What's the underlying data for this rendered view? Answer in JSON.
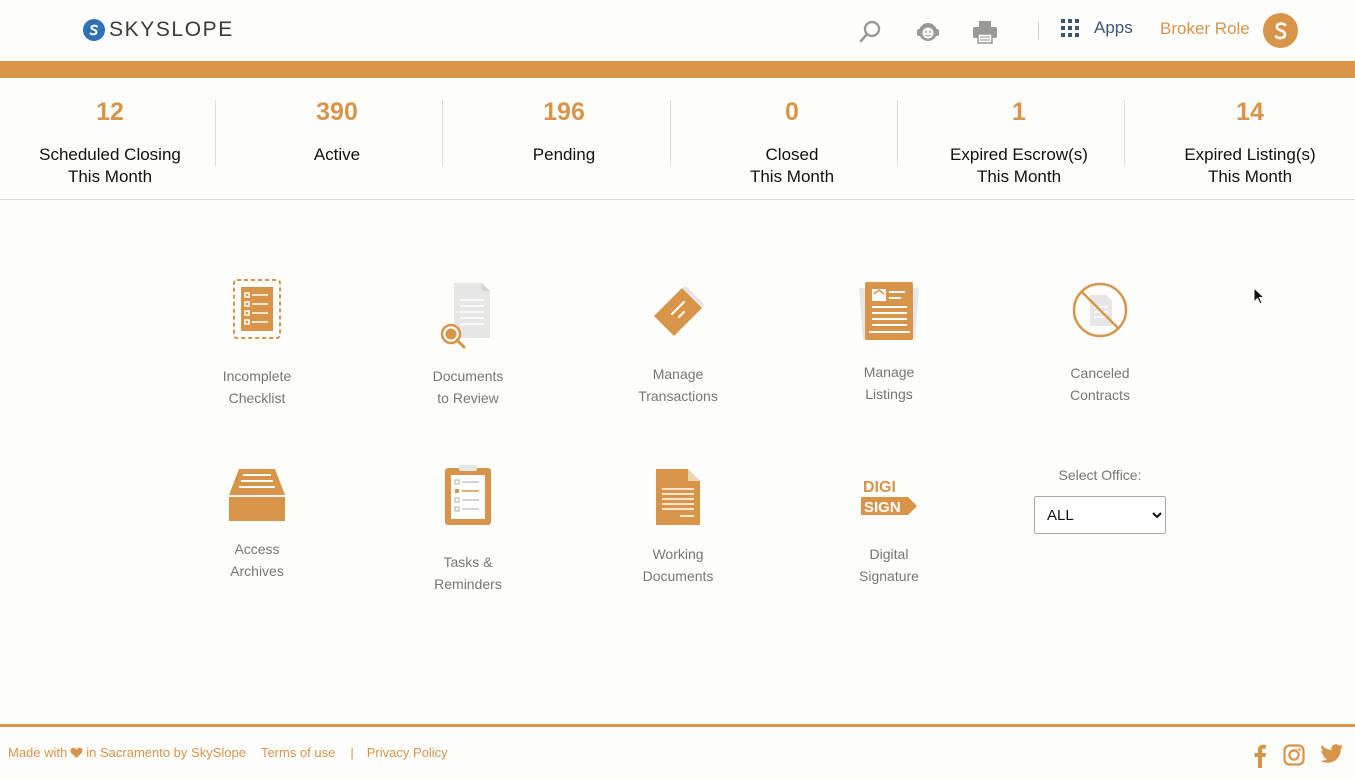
{
  "header": {
    "brand": "SKYSLOPE",
    "apps_label": "Apps",
    "role_label": "Broker Role",
    "icons": [
      "search-icon",
      "support-agent-icon",
      "printer-icon",
      "grid-apps-icon"
    ]
  },
  "colors": {
    "accent": "#d8954a",
    "brand_blue": "#2f6fb4",
    "apps_text": "#3b5574"
  },
  "stats": [
    {
      "value": "12",
      "label_line1": "Scheduled Closing",
      "label_line2": "This Month"
    },
    {
      "value": "390",
      "label_line1": "Active",
      "label_line2": ""
    },
    {
      "value": "196",
      "label_line1": "Pending",
      "label_line2": ""
    },
    {
      "value": "0",
      "label_line1": "Closed",
      "label_line2": "This Month"
    },
    {
      "value": "1",
      "label_line1": "Expired Escrow(s)",
      "label_line2": "This Month"
    },
    {
      "value": "14",
      "label_line1": "Expired Listing(s)",
      "label_line2": "This Month"
    }
  ],
  "tiles": [
    {
      "line1": "Incomplete",
      "line2": "Checklist",
      "icon": "checklist-icon"
    },
    {
      "line1": "Documents",
      "line2": "to Review",
      "icon": "document-review-icon"
    },
    {
      "line1": "Manage",
      "line2": "Transactions",
      "icon": "tag-icon"
    },
    {
      "line1": "Manage",
      "line2": "Listings",
      "icon": "listing-board-icon"
    },
    {
      "line1": "Canceled",
      "line2": "Contracts",
      "icon": "canceled-document-icon"
    },
    {
      "line1": "Access",
      "line2": "Archives",
      "icon": "archive-tray-icon"
    },
    {
      "line1": "Tasks &",
      "line2": "Reminders",
      "icon": "clipboard-icon"
    },
    {
      "line1": "Working",
      "line2": "Documents",
      "icon": "document-icon"
    },
    {
      "line1": "Digital",
      "line2": "Signature",
      "icon": "digisign-icon"
    }
  ],
  "digisign": {
    "top": "DIGI",
    "bottom": "SIGN"
  },
  "office": {
    "label": "Select Office:",
    "selected": "ALL"
  },
  "footer": {
    "made_with": "Made with",
    "in_place": "in Sacramento by SkySlope",
    "terms": "Terms of use",
    "separator": "|",
    "privacy": "Privacy Policy",
    "social": [
      "facebook-icon",
      "instagram-icon",
      "twitter-icon"
    ]
  }
}
